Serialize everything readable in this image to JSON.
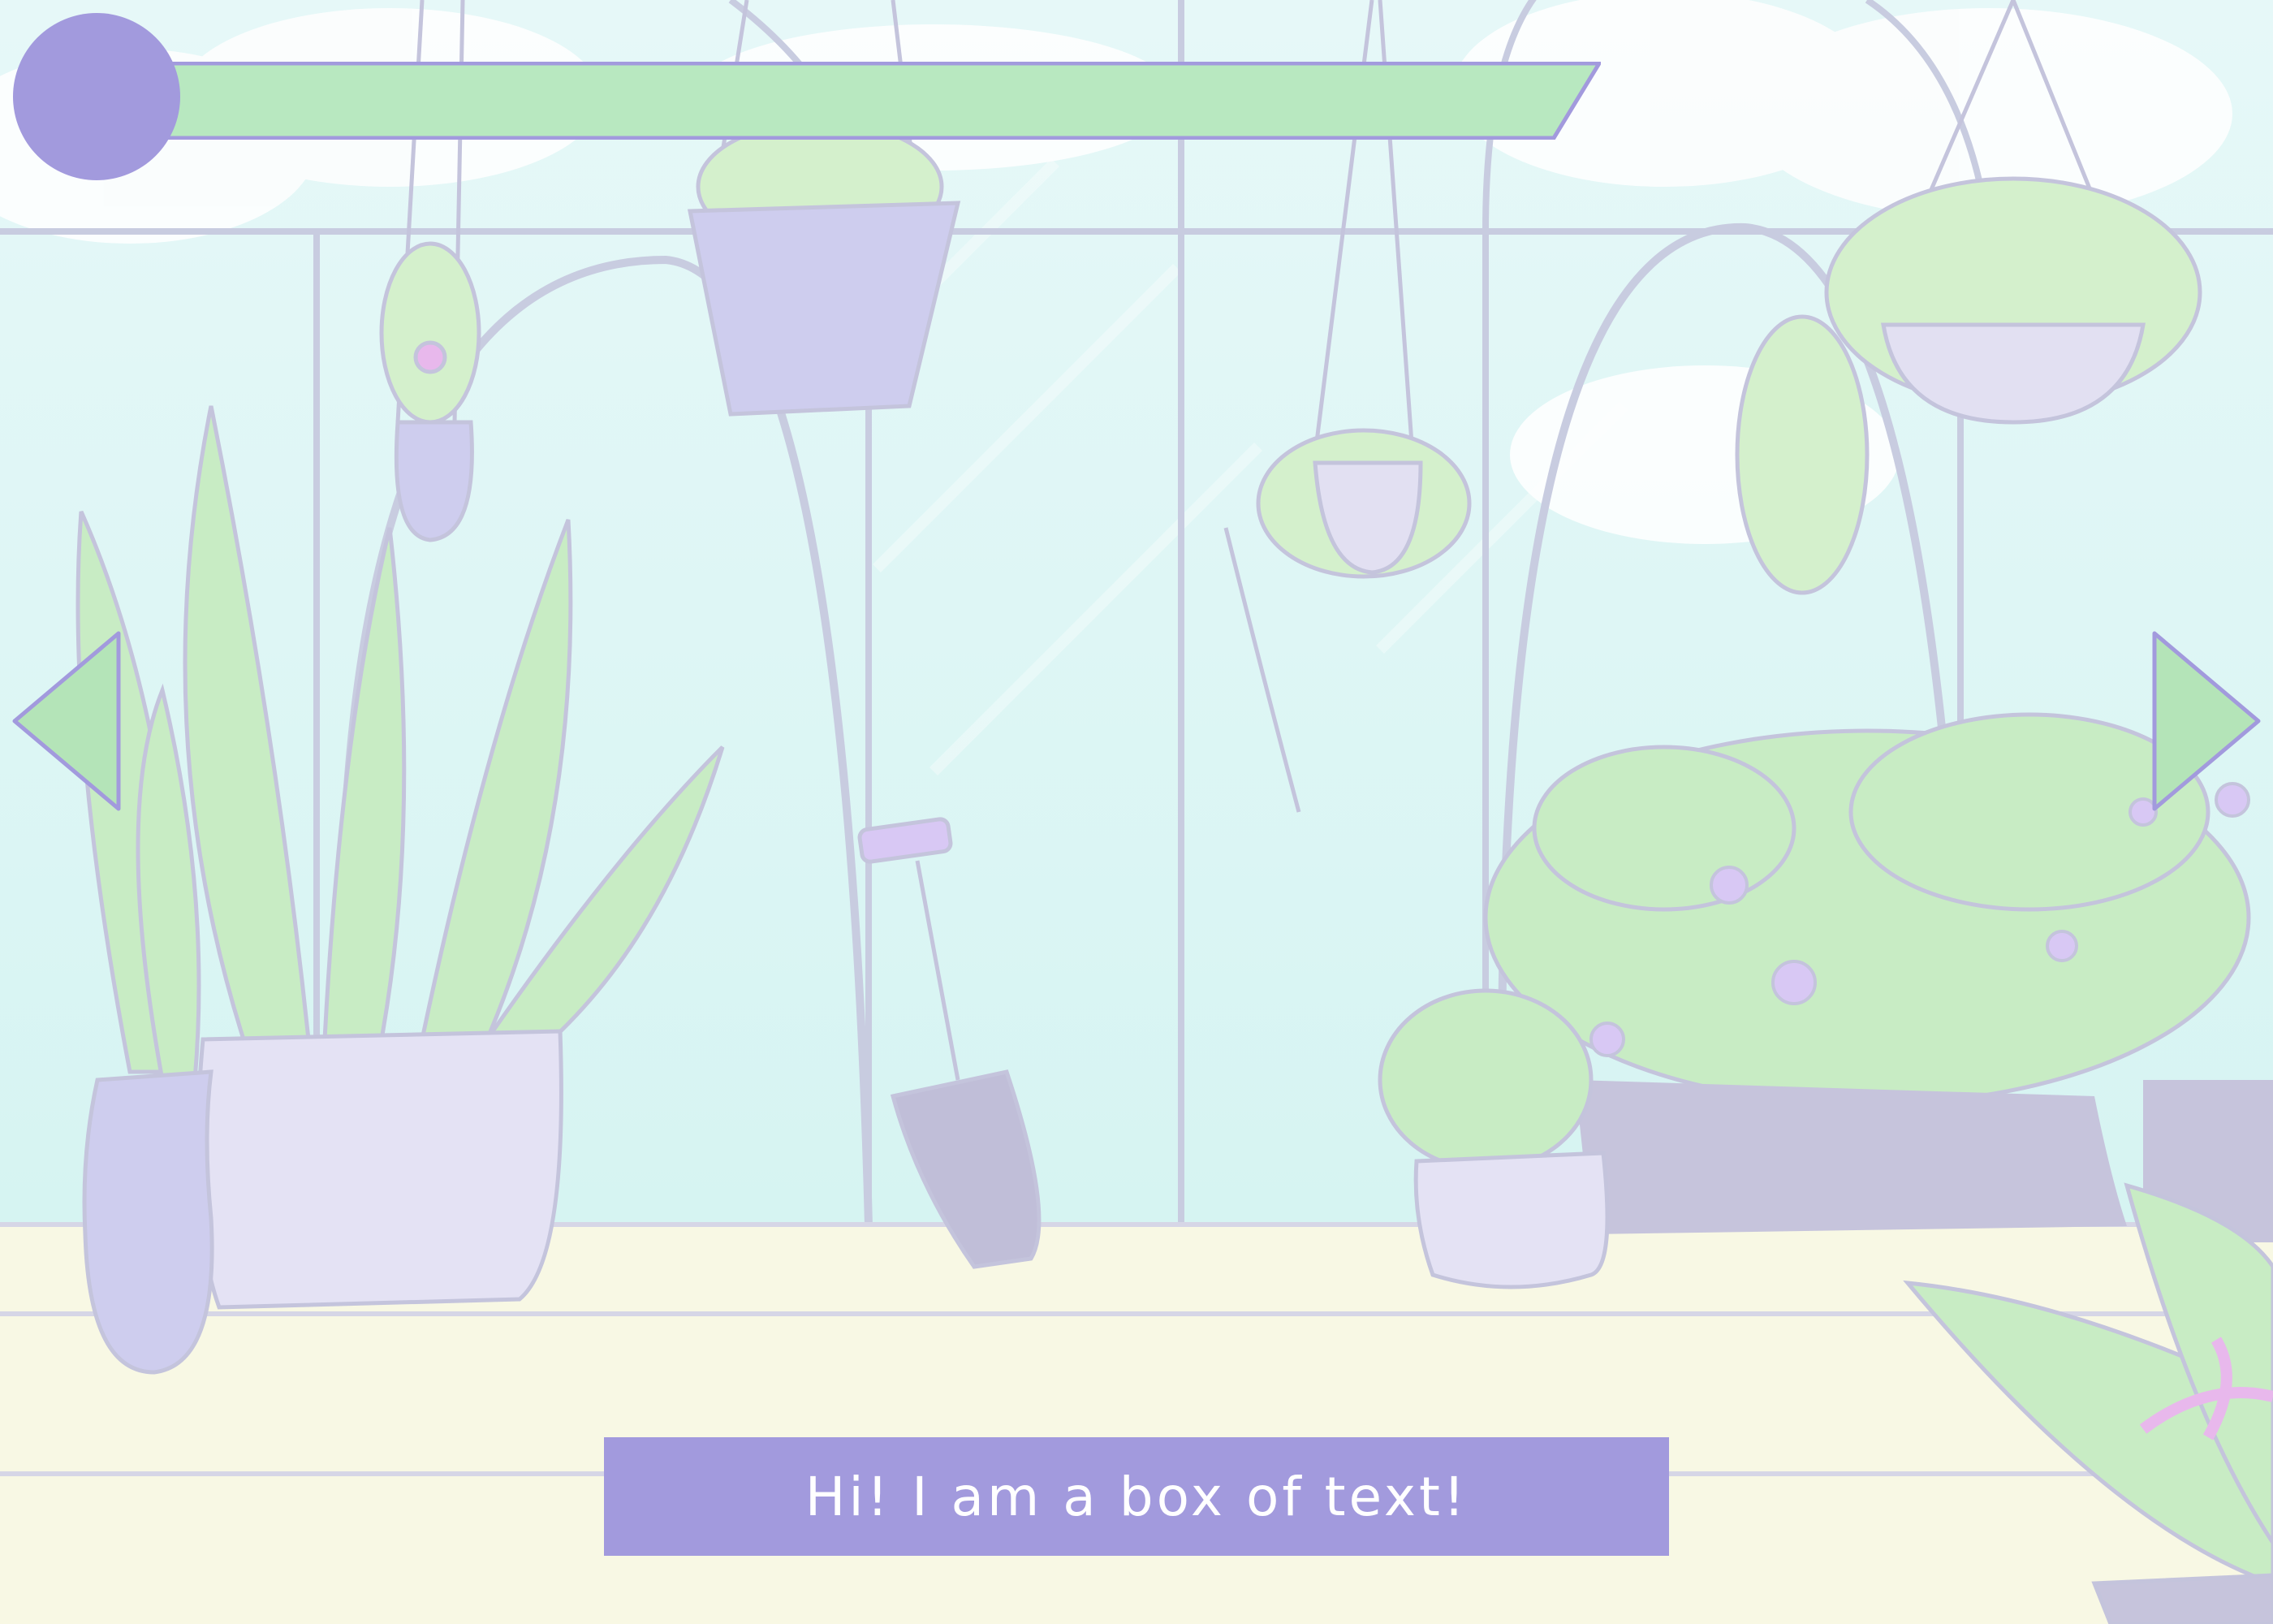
{
  "colors": {
    "accent": "#a29add",
    "bar_fill": "#b8e8c0",
    "arrow_fill": "#b4e4b8",
    "sky": "#d8f4f6",
    "floor": "#f8f8e4",
    "line": "#c4c4dc",
    "foliage": "#c8ecc4",
    "pot": "#cecdee",
    "planter": "#c6c4dc",
    "blossom": "#e8b8ec"
  },
  "hud": {
    "avatar_icon": "avatar-circle",
    "progress": 1.0
  },
  "navigation": {
    "prev_icon": "triangle-left-icon",
    "next_icon": "triangle-right-icon"
  },
  "dialog": {
    "text": "Hi! I am a box of text!"
  }
}
